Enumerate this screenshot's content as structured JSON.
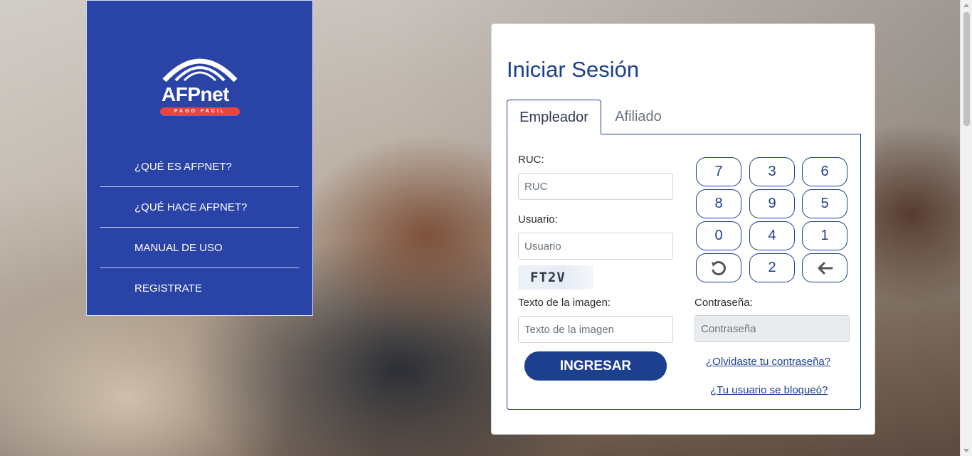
{
  "sidebar": {
    "logo": {
      "brand": "AFPnet",
      "tagline": "PAGO FACIL"
    },
    "items": [
      {
        "label": "¿QUÉ ES AFPNET?"
      },
      {
        "label": "¿QUÉ HACE AFPNET?"
      },
      {
        "label": "MANUAL DE USO"
      },
      {
        "label": "REGISTRATE"
      }
    ]
  },
  "login": {
    "title": "Iniciar Sesión",
    "tabs": [
      {
        "label": "Empleador",
        "active": true
      },
      {
        "label": "Afiliado",
        "active": false
      }
    ],
    "ruc": {
      "label": "RUC:",
      "placeholder": "RUC",
      "value": ""
    },
    "usuario": {
      "label": "Usuario:",
      "placeholder": "Usuario",
      "value": ""
    },
    "captcha": {
      "text": "FT2V"
    },
    "texto_imagen": {
      "label": "Texto de la imagen:",
      "placeholder": "Texto de la imagen",
      "value": ""
    },
    "contrasena": {
      "label": "Contraseña:",
      "placeholder": "Contraseña",
      "value": ""
    },
    "submit_label": "INGRESAR",
    "keypad": [
      [
        "7",
        "3",
        "6"
      ],
      [
        "8",
        "9",
        "5"
      ],
      [
        "0",
        "4",
        "1"
      ],
      [
        "reset-icon",
        "2",
        "backspace-icon"
      ]
    ],
    "forgot_password": "¿Olvidaste tu contraseña?",
    "locked_user": "¿Tu usuario se bloqueó?"
  },
  "colors": {
    "sidebar_bg": "#2a43a6",
    "brand_blue": "#1c3f8f",
    "tag_red": "#e8453c"
  }
}
